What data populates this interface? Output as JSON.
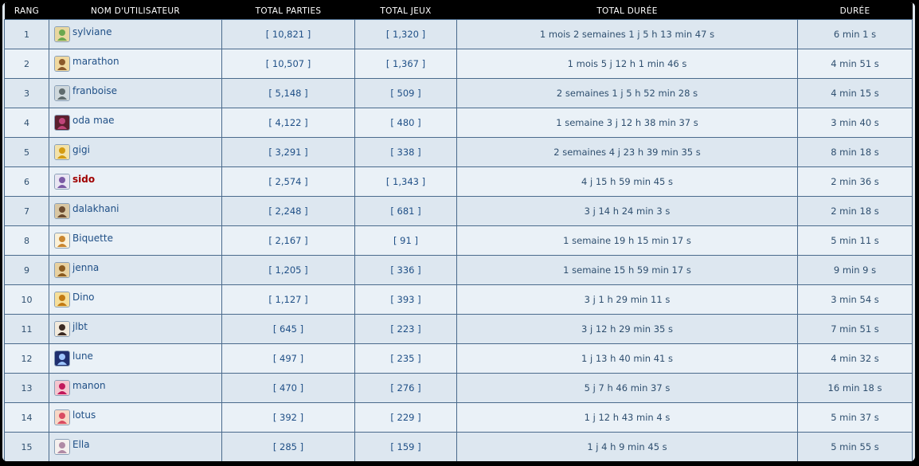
{
  "headers": {
    "rank": "RANG",
    "username": "NOM D'UTILISATEUR",
    "total_games_played": "TOTAL PARTIES",
    "total_games": "TOTAL JEUX",
    "total_duration": "TOTAL DURÉE",
    "duration": "DURÉE"
  },
  "rows": [
    {
      "rank": "1",
      "name": "sylviane",
      "parties": "[ 10,821 ]",
      "jeux": "[ 1,320 ]",
      "total_duree": "1 mois 2 semaines 1 j 5 h 13 min 47 s",
      "duree": "6 min 1 s",
      "avatar": "angel-icon",
      "highlight": false
    },
    {
      "rank": "2",
      "name": "marathon",
      "parties": "[ 10,507 ]",
      "jeux": "[ 1,367 ]",
      "total_duree": "1 mois 5 j 12 h 1 min 46 s",
      "duree": "4 min 51 s",
      "avatar": "character-icon",
      "highlight": false
    },
    {
      "rank": "3",
      "name": "franboise",
      "parties": "[ 5,148 ]",
      "jeux": "[ 509 ]",
      "total_duree": "2 semaines 1 j 5 h 52 min 28 s",
      "duree": "4 min 15 s",
      "avatar": "gargoyle-icon",
      "highlight": false
    },
    {
      "rank": "4",
      "name": "oda mae",
      "parties": "[ 4,122 ]",
      "jeux": "[ 480 ]",
      "total_duree": "1 semaine 3 j 12 h 38 min 37 s",
      "duree": "3 min 40 s",
      "avatar": "dark-figure-icon",
      "highlight": false
    },
    {
      "rank": "5",
      "name": "gigi",
      "parties": "[ 3,291 ]",
      "jeux": "[ 338 ]",
      "total_duree": "2 semaines 4 j 23 h 39 min 35 s",
      "duree": "8 min 18 s",
      "avatar": "bird-icon",
      "highlight": false
    },
    {
      "rank": "6",
      "name": "sido",
      "parties": "[ 2,574 ]",
      "jeux": "[ 1,343 ]",
      "total_duree": "4 j 15 h 59 min 45 s",
      "duree": "2 min 36 s",
      "avatar": "emblem-icon",
      "highlight": true
    },
    {
      "rank": "7",
      "name": "dalakhani",
      "parties": "[ 2,248 ]",
      "jeux": "[ 681 ]",
      "total_duree": "3 j 14 h 24 min 3 s",
      "duree": "2 min 18 s",
      "avatar": "horse-icon",
      "highlight": false
    },
    {
      "rank": "8",
      "name": "Biquette",
      "parties": "[ 2,167 ]",
      "jeux": "[ 91 ]",
      "total_duree": "1 semaine 19 h 15 min 17 s",
      "duree": "5 min 11 s",
      "avatar": "goat-icon",
      "highlight": false
    },
    {
      "rank": "9",
      "name": "jenna",
      "parties": "[ 1,205 ]",
      "jeux": "[ 336 ]",
      "total_duree": "1 semaine 15 h 59 min 17 s",
      "duree": "9 min 9 s",
      "avatar": "house-icon",
      "highlight": false
    },
    {
      "rank": "10",
      "name": "Dino",
      "parties": "[ 1,127 ]",
      "jeux": "[ 393 ]",
      "total_duree": "3 j 1 h 29 min 11 s",
      "duree": "3 min 54 s",
      "avatar": "lion-icon",
      "highlight": false
    },
    {
      "rank": "11",
      "name": "jlbt",
      "parties": "[ 645 ]",
      "jeux": "[ 223 ]",
      "total_duree": "3 j 12 h 29 min 35 s",
      "duree": "7 min 51 s",
      "avatar": "horse-rider-icon",
      "highlight": false
    },
    {
      "rank": "12",
      "name": "lune",
      "parties": "[ 497 ]",
      "jeux": "[ 235 ]",
      "total_duree": "1 j 13 h 40 min 41 s",
      "duree": "4 min 32 s",
      "avatar": "night-icon",
      "highlight": false
    },
    {
      "rank": "13",
      "name": "manon",
      "parties": "[ 470 ]",
      "jeux": "[ 276 ]",
      "total_duree": "5 j 7 h 46 min 37 s",
      "duree": "16 min 18 s",
      "avatar": "heart-icon",
      "highlight": false
    },
    {
      "rank": "14",
      "name": "lotus",
      "parties": "[ 392 ]",
      "jeux": "[ 229 ]",
      "total_duree": "1 j 12 h 43 min 4 s",
      "duree": "5 min 37 s",
      "avatar": "flower-icon",
      "highlight": false
    },
    {
      "rank": "15",
      "name": "Ella",
      "parties": "[ 285 ]",
      "jeux": "[ 159 ]",
      "total_duree": "1 j 4 h 9 min 45 s",
      "duree": "5 min 55 s",
      "avatar": "fairy-icon",
      "highlight": false
    }
  ],
  "colors": {
    "header_bg": "#000000",
    "header_text": "#ffffff",
    "row_odd": "#dde7f0",
    "row_even": "#eaf1f7",
    "grid_line": "#4a6a8c",
    "link": "#1f4f86",
    "highlight": "#a00000"
  }
}
